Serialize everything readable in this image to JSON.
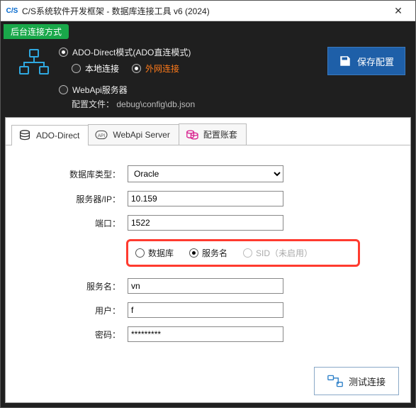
{
  "window": {
    "app_icon_text": "C/S",
    "title": "C/S系统软件开发框架 - 数据库连接工具 v6 (2024)",
    "close": "✕"
  },
  "top": {
    "badge": "后台连接方式",
    "mode_ado": "ADO-Direct模式(ADO直连模式)",
    "mode_local": "本地连接",
    "mode_external": "外网连接",
    "mode_webapi": "WebApi服务器",
    "cfg_label": "配置文件：",
    "cfg_path": "debug\\config\\db.json",
    "save": "保存配置"
  },
  "tabs": {
    "t1": "ADO-Direct",
    "t2": "WebApi Server",
    "t3": "配置账套"
  },
  "form": {
    "dbtype_label": "数据库类型：",
    "dbtype_value": "Oracle",
    "server_label": "服务器/IP：",
    "server_value": "10.159",
    "port_label": "端口：",
    "port_value": "1522",
    "r_database": "数据库",
    "r_service": "服务名",
    "r_sid": "SID（未启用）",
    "service_label": "服务名：",
    "service_value": "vn",
    "user_label": "用户：",
    "user_value": "f",
    "pwd_label": "密码：",
    "pwd_value": "*********"
  },
  "bottom": {
    "test": "测试连接"
  }
}
